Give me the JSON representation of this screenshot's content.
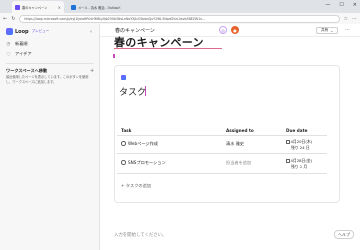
{
  "browser": {
    "tabs": [
      {
        "label": "春のキャンペーン",
        "icon_color": "#6a4cf5"
      },
      {
        "label": "メール - 清水 雅治 - Outlook",
        "icon_color": "#1e74d9"
      }
    ],
    "url": "https://loop.microsoft.com/p/eyJ1IjoiaHR0cHM6Ly9jb250b3NvLnNoYXJlcG9pbnQuY29tL3NpdGVzL0xvb3BEZW1v..."
  },
  "sidebar": {
    "brand": "Loop",
    "badge": "プレビュー",
    "items": [
      {
        "label": "新着順",
        "icon": "clock-icon"
      },
      {
        "label": "アイデア",
        "icon": "lightbulb-icon"
      }
    ],
    "workspaces_title": "ワークスペースへ移動",
    "workspaces_desc": "最近使用したページを表示しています。このボタンを使用し、ワークスペースに追加します。"
  },
  "header": {
    "title": "春のキャンペーン",
    "share_label": "共有"
  },
  "page": {
    "title": "春のキャンペーン",
    "component_title": "タスク",
    "columns": {
      "task": "Task",
      "assigned": "Assigned to",
      "due": "Due date"
    },
    "rows": [
      {
        "task": "Webページ作成",
        "assigned": "清水 雅史",
        "assigned_placeholder": false,
        "due_date": "4月20日(木)",
        "due_rel": "残り 24 日"
      },
      {
        "task": "SNSプロモーション",
        "assigned": "担当者を追加",
        "assigned_placeholder": true,
        "due_date": "4月28日(金)",
        "due_rel": "残り 1 月"
      }
    ],
    "add_task": "タスクの追加",
    "input_hint": "入力を開始してください。",
    "help_label": "ヘルプ"
  }
}
